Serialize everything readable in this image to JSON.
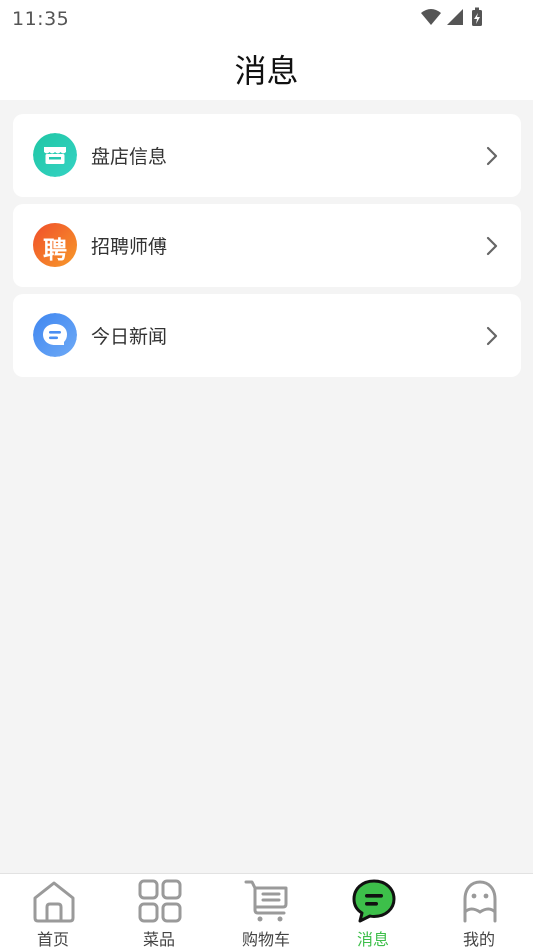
{
  "status_bar": {
    "time": "11:35"
  },
  "header": {
    "title": "消息"
  },
  "list": [
    {
      "label": "盘店信息",
      "icon": "storefront-icon",
      "color": "#27c8b0"
    },
    {
      "label": "招聘师傅",
      "icon": "recruit-icon",
      "icon_text": "聘",
      "color": "#f26a2a"
    },
    {
      "label": "今日新闻",
      "icon": "chat-bubble-icon",
      "color": "#4a8ef2"
    }
  ],
  "tabs": [
    {
      "label": "首页",
      "icon": "home-icon"
    },
    {
      "label": "菜品",
      "icon": "grid-icon"
    },
    {
      "label": "购物车",
      "icon": "cart-icon"
    },
    {
      "label": "消息",
      "icon": "message-icon",
      "active": true
    },
    {
      "label": "我的",
      "icon": "profile-icon"
    }
  ],
  "colors": {
    "accent": "#3dbf4a",
    "background": "#f4f4f4"
  }
}
